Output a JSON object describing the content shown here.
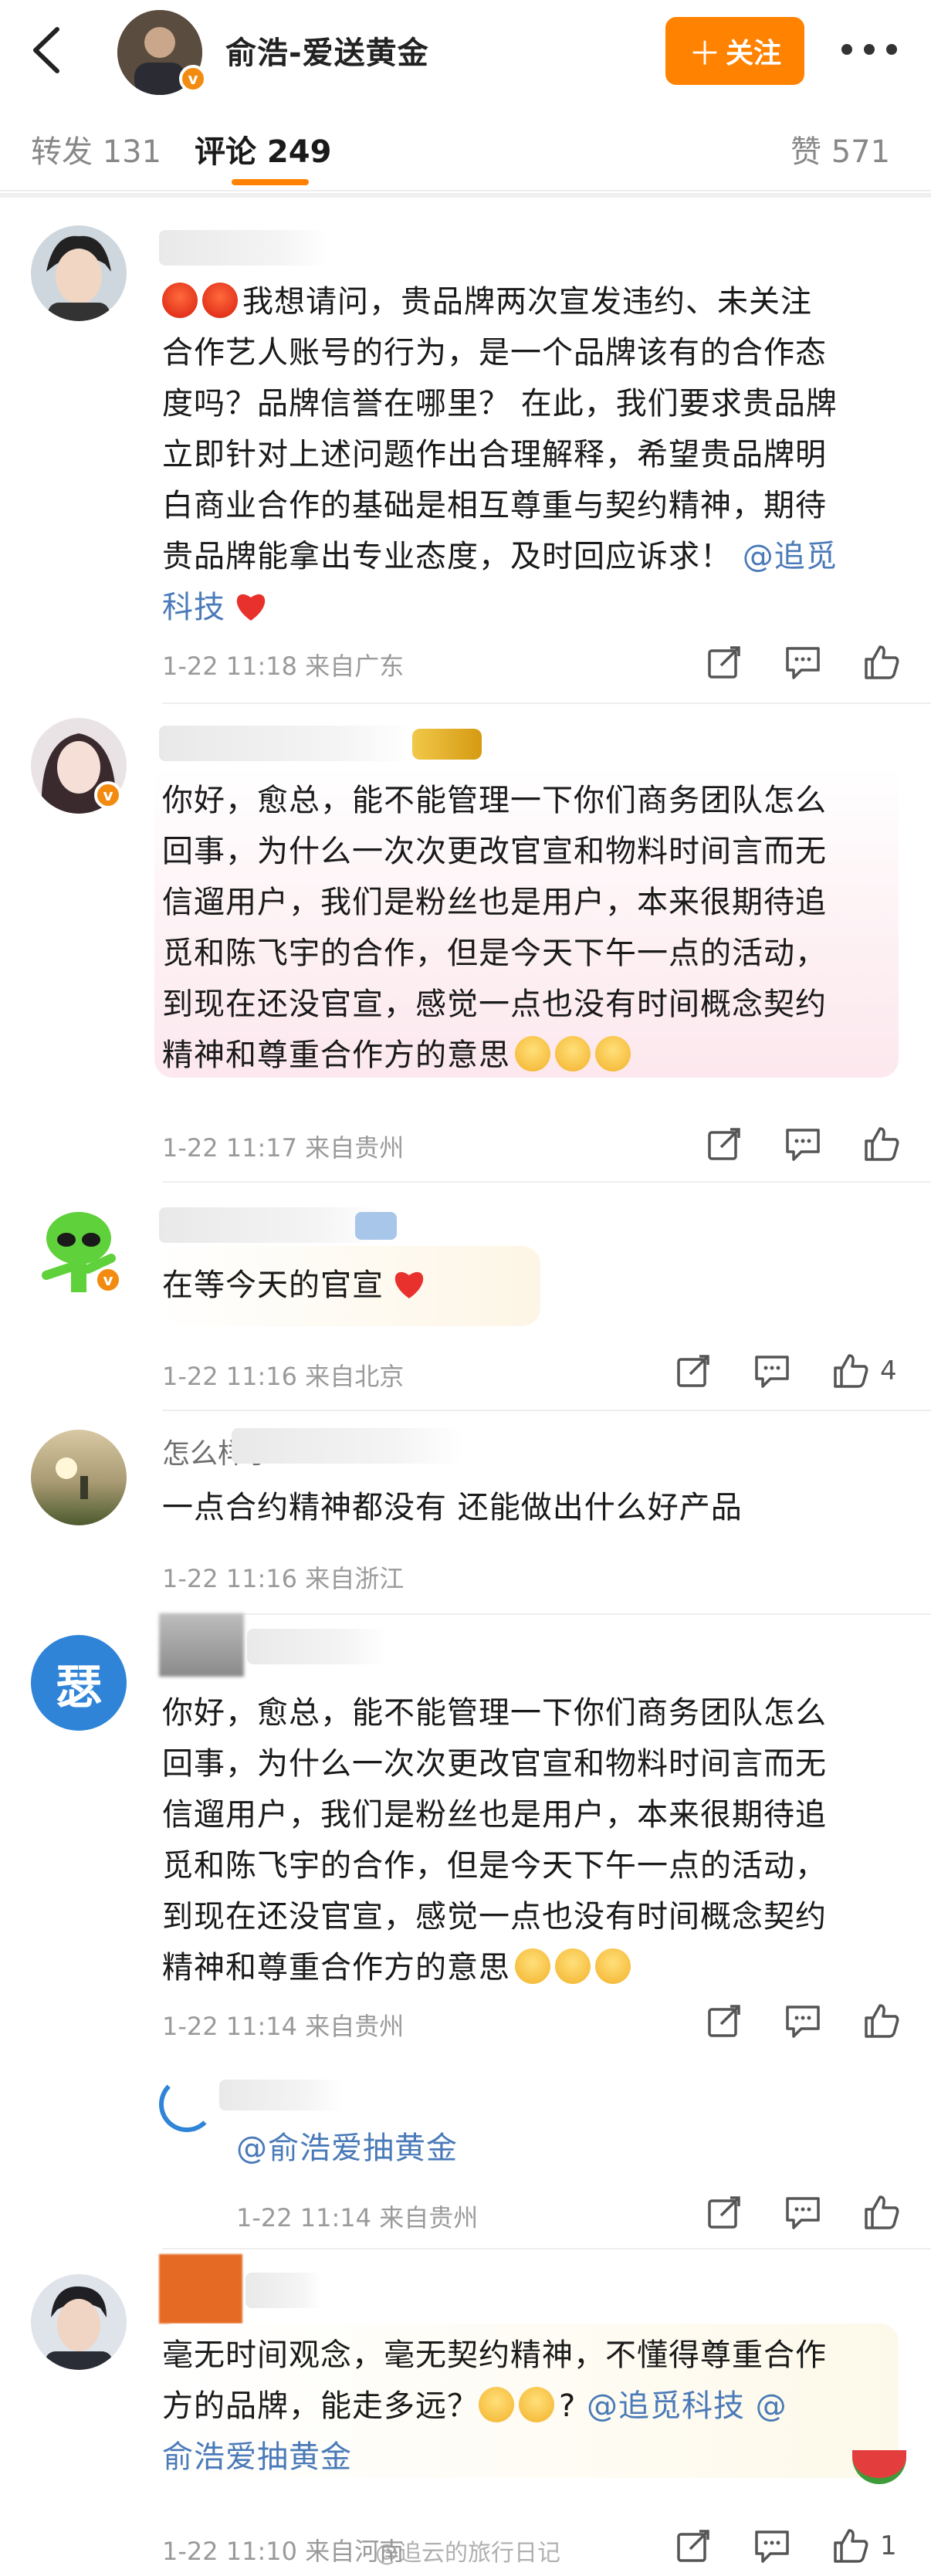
{
  "header": {
    "title": "俞浩-爱送黄金",
    "follow_label": "关注"
  },
  "tabs": [
    {
      "label": "转发 131"
    },
    {
      "label": "评论 249"
    },
    {
      "label": "赞 571"
    }
  ],
  "comments": [
    {
      "text1": "我想请问，贵品牌两次宣发违约、未关注",
      "text2": "合作艺人账号的行为，是一个品牌该有的合作态",
      "text3": "度吗？品牌信誉在哪里？ 在此，我们要求贵品牌",
      "text4": "立即针对上述问题作出合理解释，希望贵品牌明",
      "text5": "白商业合作的基础是相互尊重与契约精神，期待",
      "text6": "贵品牌能拿出专业态度，及时回应诉求！",
      "mention": "@追觅",
      "text7": "科技",
      "meta": "1-22 11:18  来自广东"
    },
    {
      "text1": "你好，愈总，能不能管理一下你们商务团队怎么",
      "text2": "回事，为什么一次次更改官宣和物料时间言而无",
      "text3": "信遛用户，我们是粉丝也是用户，本来很期待追",
      "text4": "觅和陈飞宇的合作，但是今天下午一点的活动，",
      "text5": "到现在还没官宣，感觉一点也没有时间概念契约",
      "text6": "精神和尊重合作方的意思",
      "meta": "1-22 11:17  来自贵州"
    },
    {
      "text1": "在等今天的官宣",
      "meta": "1-22 11:16  来自北京",
      "likes": "4"
    },
    {
      "name_partial": "怎么样了",
      "text1": "一点合约精神都没有 还能做出什么好产品",
      "meta": "1-22 11:16  来自浙江"
    },
    {
      "avatar_char": "瑟",
      "text1": "你好，愈总，能不能管理一下你们商务团队怎么",
      "text2": "回事，为什么一次次更改官宣和物料时间言而无",
      "text3": "信遛用户，我们是粉丝也是用户，本来很期待追",
      "text4": "觅和陈飞宇的合作，但是今天下午一点的活动，",
      "text5": "到现在还没官宣，感觉一点也没有时间概念契约",
      "text6": "精神和尊重合作方的意思",
      "meta": "1-22 11:14  来自贵州"
    },
    {
      "mention": "@俞浩爱抽黄金",
      "meta": "1-22 11:14  来自贵州"
    },
    {
      "text1": "毫无时间观念，毫无契约精神，不懂得尊重合作",
      "text2a": "方的品牌，能走多远？",
      "mention1": "@追觅科技",
      "mention2a": "@",
      "mention2b": "俞浩爱抽黄金",
      "meta": "1-22 11:10  来自河南",
      "likes": "1"
    }
  ],
  "watermark": "@追云的旅行日记"
}
